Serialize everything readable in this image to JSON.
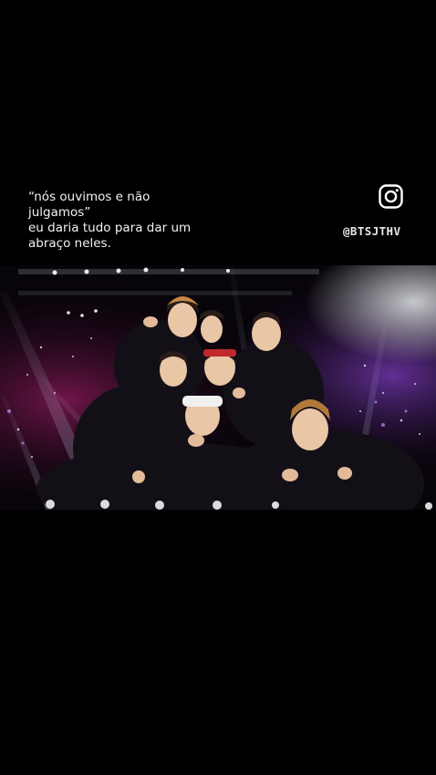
{
  "caption": {
    "line1": "“nós ouvimos e não",
    "line2": "julgamos”",
    "line3": "eu daria tudo para dar um",
    "line4": "abraço neles."
  },
  "watermark": {
    "icon": "instagram-icon",
    "handle": "@BTSJTHV"
  },
  "photo": {
    "subject": "concert-group-photo"
  },
  "colors": {
    "background": "#000000",
    "text": "#ffffff"
  }
}
